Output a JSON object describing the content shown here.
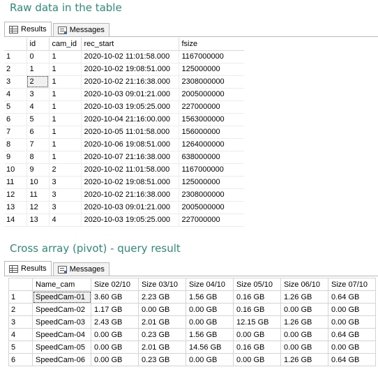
{
  "section1": {
    "heading": "Raw data in the table",
    "tabs": {
      "results": "Results",
      "messages": "Messages"
    },
    "columns": [
      "",
      "id",
      "cam_id",
      "rec_start",
      "fsize"
    ],
    "rows": [
      [
        "1",
        "0",
        "1",
        "2020-10-02 11:01:58.000",
        "1167000000"
      ],
      [
        "2",
        "1",
        "1",
        "2020-10-02 19:08:51.000",
        "125000000"
      ],
      [
        "3",
        "2",
        "1",
        "2020-10-02 21:16:38.000",
        "2308000000"
      ],
      [
        "4",
        "3",
        "1",
        "2020-10-03 09:01:21.000",
        "2005000000"
      ],
      [
        "5",
        "4",
        "1",
        "2020-10-03 19:05:25.000",
        "227000000"
      ],
      [
        "6",
        "5",
        "1",
        "2020-10-04 21:16:00.000",
        "1563000000"
      ],
      [
        "7",
        "6",
        "1",
        "2020-10-05 11:01:58.000",
        "156000000"
      ],
      [
        "8",
        "7",
        "1",
        "2020-10-06 19:08:51.000",
        "1264000000"
      ],
      [
        "9",
        "8",
        "1",
        "2020-10-07 21:16:38.000",
        "638000000"
      ],
      [
        "10",
        "9",
        "2",
        "2020-10-02 11:01:58.000",
        "1167000000"
      ],
      [
        "11",
        "10",
        "3",
        "2020-10-02 19:08:51.000",
        "125000000"
      ],
      [
        "12",
        "11",
        "3",
        "2020-10-02 21:16:38.000",
        "2308000000"
      ],
      [
        "13",
        "12",
        "3",
        "2020-10-03 09:01:21.000",
        "2005000000"
      ],
      [
        "14",
        "13",
        "4",
        "2020-10-03 19:05:25.000",
        "227000000"
      ]
    ]
  },
  "section2": {
    "heading": "Cross array (pivot) - query result",
    "tabs": {
      "results": "Results",
      "messages": "Messages"
    },
    "columns": [
      "",
      "Name_cam",
      "Size 02/10",
      "Size 03/10",
      "Size 04/10",
      "Size 05/10",
      "Size 06/10",
      "Size 07/10"
    ],
    "rows": [
      [
        "1",
        "SpeedCam-01",
        "3.60 GB",
        "2.23 GB",
        "1.56 GB",
        "0.16 GB",
        "1.26 GB",
        "0.64 GB"
      ],
      [
        "2",
        "SpeedCam-02",
        "1.17 GB",
        "0.00 GB",
        "0.00 GB",
        "0.16 GB",
        "0.00 GB",
        "0.00 GB"
      ],
      [
        "3",
        "SpeedCam-03",
        "2.43 GB",
        "2.01 GB",
        "0.00 GB",
        "12.15 GB",
        "1.26 GB",
        "0.00 GB"
      ],
      [
        "4",
        "SpeedCam-04",
        "0.00 GB",
        "0.23 GB",
        "1.56 GB",
        "0.00 GB",
        "0.00 GB",
        "0.64 GB"
      ],
      [
        "5",
        "SpeedCam-05",
        "0.00 GB",
        "2.01 GB",
        "14.56 GB",
        "0.16 GB",
        "0.00 GB",
        "0.00 GB"
      ],
      [
        "6",
        "SpeedCam-06",
        "0.00 GB",
        "0.23 GB",
        "0.00 GB",
        "0.00 GB",
        "1.26 GB",
        "0.64 GB"
      ]
    ]
  }
}
